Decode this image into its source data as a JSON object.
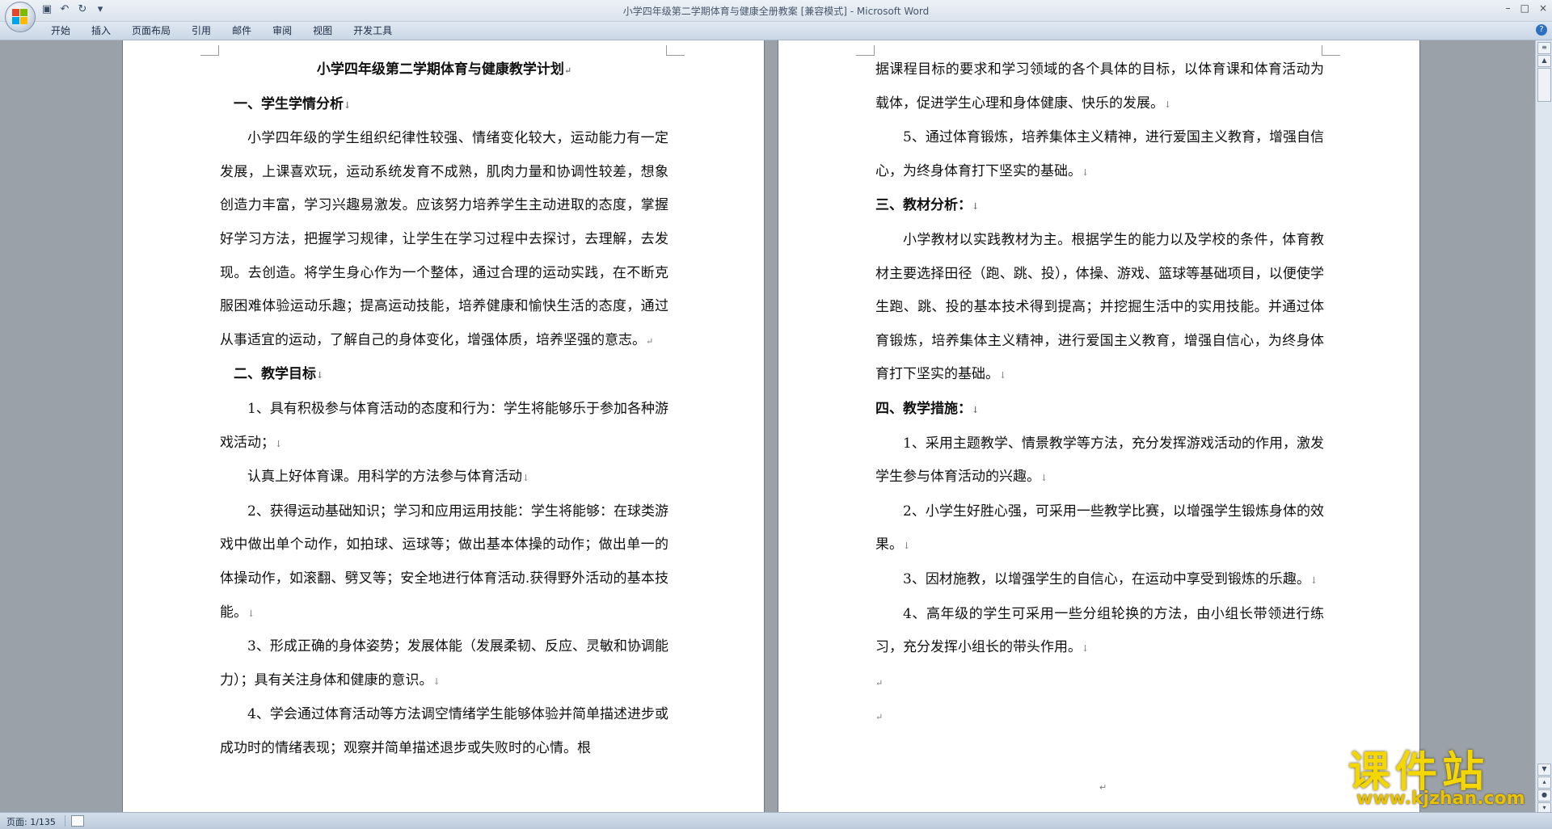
{
  "window": {
    "title": "小学四年级第二学期体育与健康全册教案 [兼容模式] - Microsoft Word",
    "controls": [
      "–",
      "□",
      "×"
    ]
  },
  "quick_access": {
    "icons": [
      "save-icon",
      "undo-icon",
      "redo-icon",
      "customize-icon"
    ]
  },
  "ribbon": {
    "tabs": [
      "开始",
      "插入",
      "页面布局",
      "引用",
      "邮件",
      "审阅",
      "视图",
      "开发工具"
    ]
  },
  "left_page": {
    "title": "小学四年级第二学期体育与健康教学计划",
    "h1": "一、学生学情分析",
    "p1": "小学四年级的学生组织纪律性较强、情绪变化较大，运动能力有一定发展，上课喜欢玩，运动系统发育不成熟，肌肉力量和协调性较差，想象创造力丰富，学习兴趣易激发。应该努力培养学生主动进取的态度，掌握好学习方法，把握学习规律，让学生在学习过程中去探讨，去理解，去发现。去创造。将学生身心作为一个整体，通过合理的运动实践，在不断克服困难体验运动乐趣；提高运动技能，培养健康和愉快生活的态度，通过从事适宜的运动，了解自己的身体变化，增强体质，培养坚强的意志。",
    "h2": "二、教学目标",
    "g1": "1、具有积极参与体育活动的态度和行为：学生将能够乐于参加各种游戏活动；",
    "g1b": "认真上好体育课。用科学的方法参与体育活动",
    "g2": "2、获得运动基础知识；学习和应用运用技能：学生将能够：在球类游戏中做出单个动作，如拍球、运球等；做出基本体操的动作；做出单一的体操动作，如滚翻、劈叉等；安全地进行体育活动.获得野外活动的基本技能。",
    "g3": "3、形成正确的身体姿势；发展体能（发展柔韧、反应、灵敏和协调能力）；具有关注身体和健康的意识。",
    "g4": "4、学会通过体育活动等方法调空情绪学生能够体验并简单描述进步或成功时的情绪表现；观察并简单描述退步或失败时的心情。根"
  },
  "right_page": {
    "p0": "据课程目标的要求和学习领域的各个具体的目标，以体育课和体育活动为载体，促进学生心理和身体健康、快乐的发展。",
    "g5": "5、通过体育锻炼，培养集体主义精神，进行爱国主义教育，增强自信心，为终身体育打下坚实的基础。",
    "h3": "三、教材分析：",
    "p2": "小学教材以实践教材为主。根据学生的能力以及学校的条件，体育教材主要选择田径（跑、跳、投），体操、游戏、篮球等基础项目，以便使学生跑、跳、投的基本技术得到提高；并挖掘生活中的实用技能。并通过体育锻炼，培养集体主义精神，进行爱国主义教育，增强自信心，为终身体育打下坚实的基础。",
    "h4": "四、教学措施：",
    "m1": "1、采用主题教学、情景教学等方法，充分发挥游戏活动的作用，激发学生参与体育活动的兴趣。",
    "m2": "2、小学生好胜心强，可采用一些教学比赛，以增强学生锻炼身体的效果。",
    "m3": "3、因材施教，以增强学生的自信心，在运动中享受到锻炼的乐趣。",
    "m4": "4、高年级的学生可采用一些分组轮换的方法，由小组长带领进行练习，充分发挥小组长的带头作用。"
  },
  "marks": {
    "para": "↵",
    "arrow": "↓"
  },
  "status": {
    "page": "页面: 1/135"
  },
  "watermark": {
    "cn": "课件站",
    "url": "www.kjzhan.com"
  }
}
